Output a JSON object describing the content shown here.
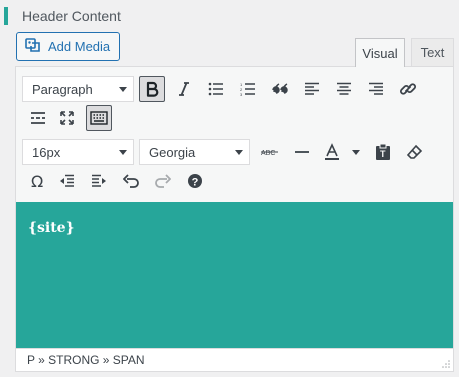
{
  "section": {
    "title": "Header Content"
  },
  "media": {
    "add_label": "Add Media"
  },
  "tabs": {
    "visual": "Visual",
    "text": "Text"
  },
  "toolbar": {
    "format_select": "Paragraph",
    "font_size_select": "16px",
    "font_family_select": "Georgia"
  },
  "content": {
    "text": "{site}"
  },
  "statusbar": {
    "path": "P » STRONG » SPAN"
  },
  "colors": {
    "accent": "#26a69a",
    "link": "#2271b1"
  }
}
